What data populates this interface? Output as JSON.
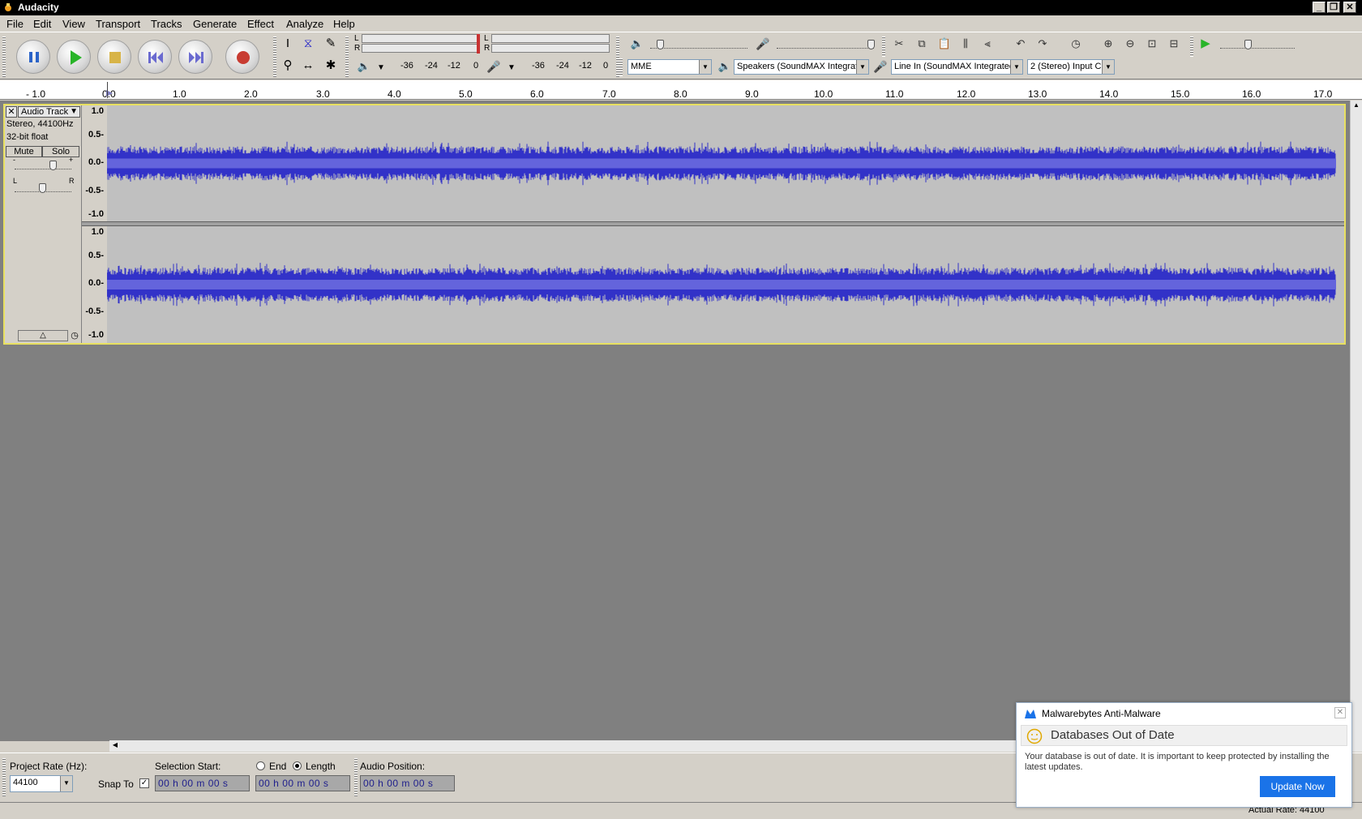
{
  "window": {
    "title": "Audacity"
  },
  "menu": [
    "File",
    "Edit",
    "View",
    "Transport",
    "Tracks",
    "Generate",
    "Effect",
    "Analyze",
    "Help"
  ],
  "meter": {
    "left": "L",
    "right": "R",
    "play_scale": [
      "-36",
      "-24",
      "-12",
      "0"
    ],
    "rec_scale": [
      "-36",
      "-24",
      "-12",
      "0"
    ]
  },
  "devices": {
    "host": "MME",
    "output": "Speakers (SoundMAX Integrat",
    "input": "Line In (SoundMAX Integrated",
    "channels": "2 (Stereo) Input C"
  },
  "ruler_ticks": [
    "- 1.0",
    "0.0",
    "1.0",
    "2.0",
    "3.0",
    "4.0",
    "5.0",
    "6.0",
    "7.0",
    "8.0",
    "9.0",
    "10.0",
    "11.0",
    "12.0",
    "13.0",
    "14.0",
    "15.0",
    "16.0",
    "17.0"
  ],
  "track": {
    "name": "Audio Track",
    "format": "Stereo, 44100Hz",
    "sample": "32-bit float",
    "mute": "Mute",
    "solo": "Solo",
    "gain_minus": "-",
    "gain_plus": "+",
    "pan_left": "L",
    "pan_right": "R",
    "scale_labels": [
      "1.0",
      "0.5-",
      "0.0-",
      "-0.5-",
      "-1.0"
    ],
    "wave_color": "#3232c8"
  },
  "selection": {
    "project_rate_label": "Project Rate (Hz):",
    "project_rate": "44100",
    "snap_to": "Snap To",
    "selection_start_label": "Selection Start:",
    "end_label": "End",
    "length_label": "Length",
    "audio_position_label": "Audio Position:",
    "time_value": "00 h 00 m 00 s"
  },
  "status": {
    "actual_rate": "Actual Rate: 44100"
  },
  "popup": {
    "app": "Malwarebytes Anti-Malware",
    "title": "Databases Out of Date",
    "message": "Your database is out of date. It is important to keep protected by installing the latest updates.",
    "button": "Update Now",
    "accent": "#1a73e8"
  }
}
